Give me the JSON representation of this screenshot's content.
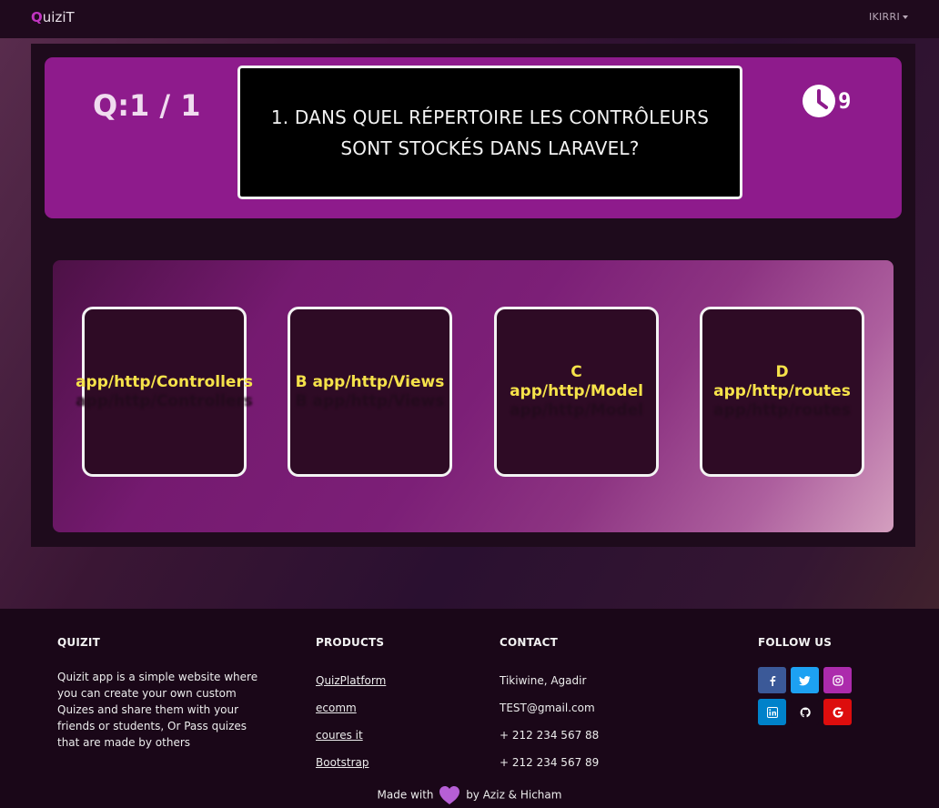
{
  "app": {
    "brand_first": "Q",
    "brand_rest": "uiziT",
    "user": "IKIRRI"
  },
  "quiz": {
    "counter": "Q:1 / 1",
    "question": "1. DANS QUEL RÉPERTOIRE LES CONTRÔLEURS SONT STOCKÉS DANS LARAVEL?",
    "timer_value": "9",
    "answers": [
      {
        "label": "app/http/Controllers",
        "shadow": "app/http/Controllers"
      },
      {
        "label": "B app/http/Views",
        "shadow": "B app/http/Views"
      },
      {
        "label": "C app/http/Model",
        "shadow": "app/http/Model"
      },
      {
        "label": "D app/http/routes",
        "shadow": "app/http/routes"
      }
    ]
  },
  "footer": {
    "about_heading": "QUIZIT",
    "about_text": "Quizit app is a simple website where you can create your own custom Quizes and share them with your friends or students, Or Pass quizes that are made by others",
    "products_heading": "PRODUCTS",
    "products": [
      "QuizPlatform",
      "ecomm",
      "coures it",
      "Bootstrap"
    ],
    "contact_heading": "CONTACT",
    "contact": [
      "Tikiwine, Agadir",
      "TEST@gmail.com",
      "+ 212 234 567 88",
      "+ 212 234 567 89"
    ],
    "follow_heading": "FOLLOW US",
    "social": [
      {
        "icon": "facebook-icon",
        "glyph": "f",
        "color": "#3b5998"
      },
      {
        "icon": "twitter-icon",
        "glyph": "t",
        "color": "#1da1f2"
      },
      {
        "icon": "instagram-icon",
        "glyph": "ig",
        "color": "#ac2bac"
      },
      {
        "icon": "linkedin-icon",
        "glyph": "in",
        "color": "#0082ca"
      },
      {
        "icon": "github-icon",
        "glyph": "gh",
        "color": "#1a0718"
      },
      {
        "icon": "google-icon",
        "glyph": "G",
        "color": "#dd0d0d"
      }
    ],
    "credit_prefix": "Made with",
    "credit_suffix": "by Aziz & Hicham"
  },
  "colors": {
    "accent": "#8e1b8c",
    "answer_text": "#f5e24a",
    "heart": "#b65fd6"
  }
}
